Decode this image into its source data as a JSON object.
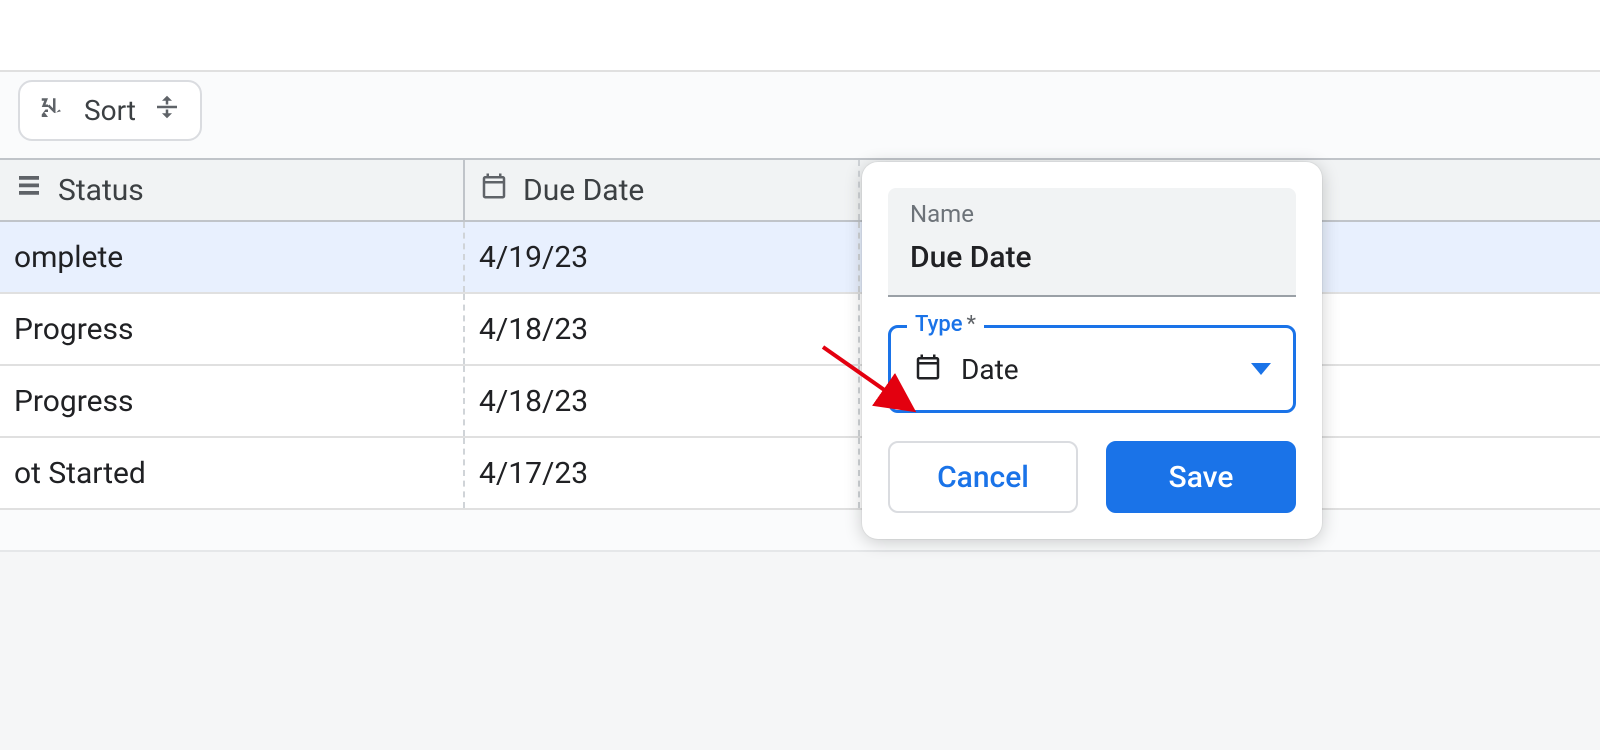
{
  "toolbar": {
    "sort_label": "Sort"
  },
  "table": {
    "columns": {
      "status": "Status",
      "due": "Due Date"
    },
    "rows": [
      {
        "status": "omplete",
        "due": "4/19/23",
        "selected": true
      },
      {
        "status": "Progress",
        "due": "4/18/23",
        "selected": false
      },
      {
        "status": "Progress",
        "due": "4/18/23",
        "selected": false
      },
      {
        "status": "ot Started",
        "due": "4/17/23",
        "selected": false
      }
    ]
  },
  "popup": {
    "name_label": "Name",
    "name_value": "Due Date",
    "type_label": "Type",
    "type_required_marker": "*",
    "type_value": "Date",
    "cancel": "Cancel",
    "save": "Save"
  }
}
